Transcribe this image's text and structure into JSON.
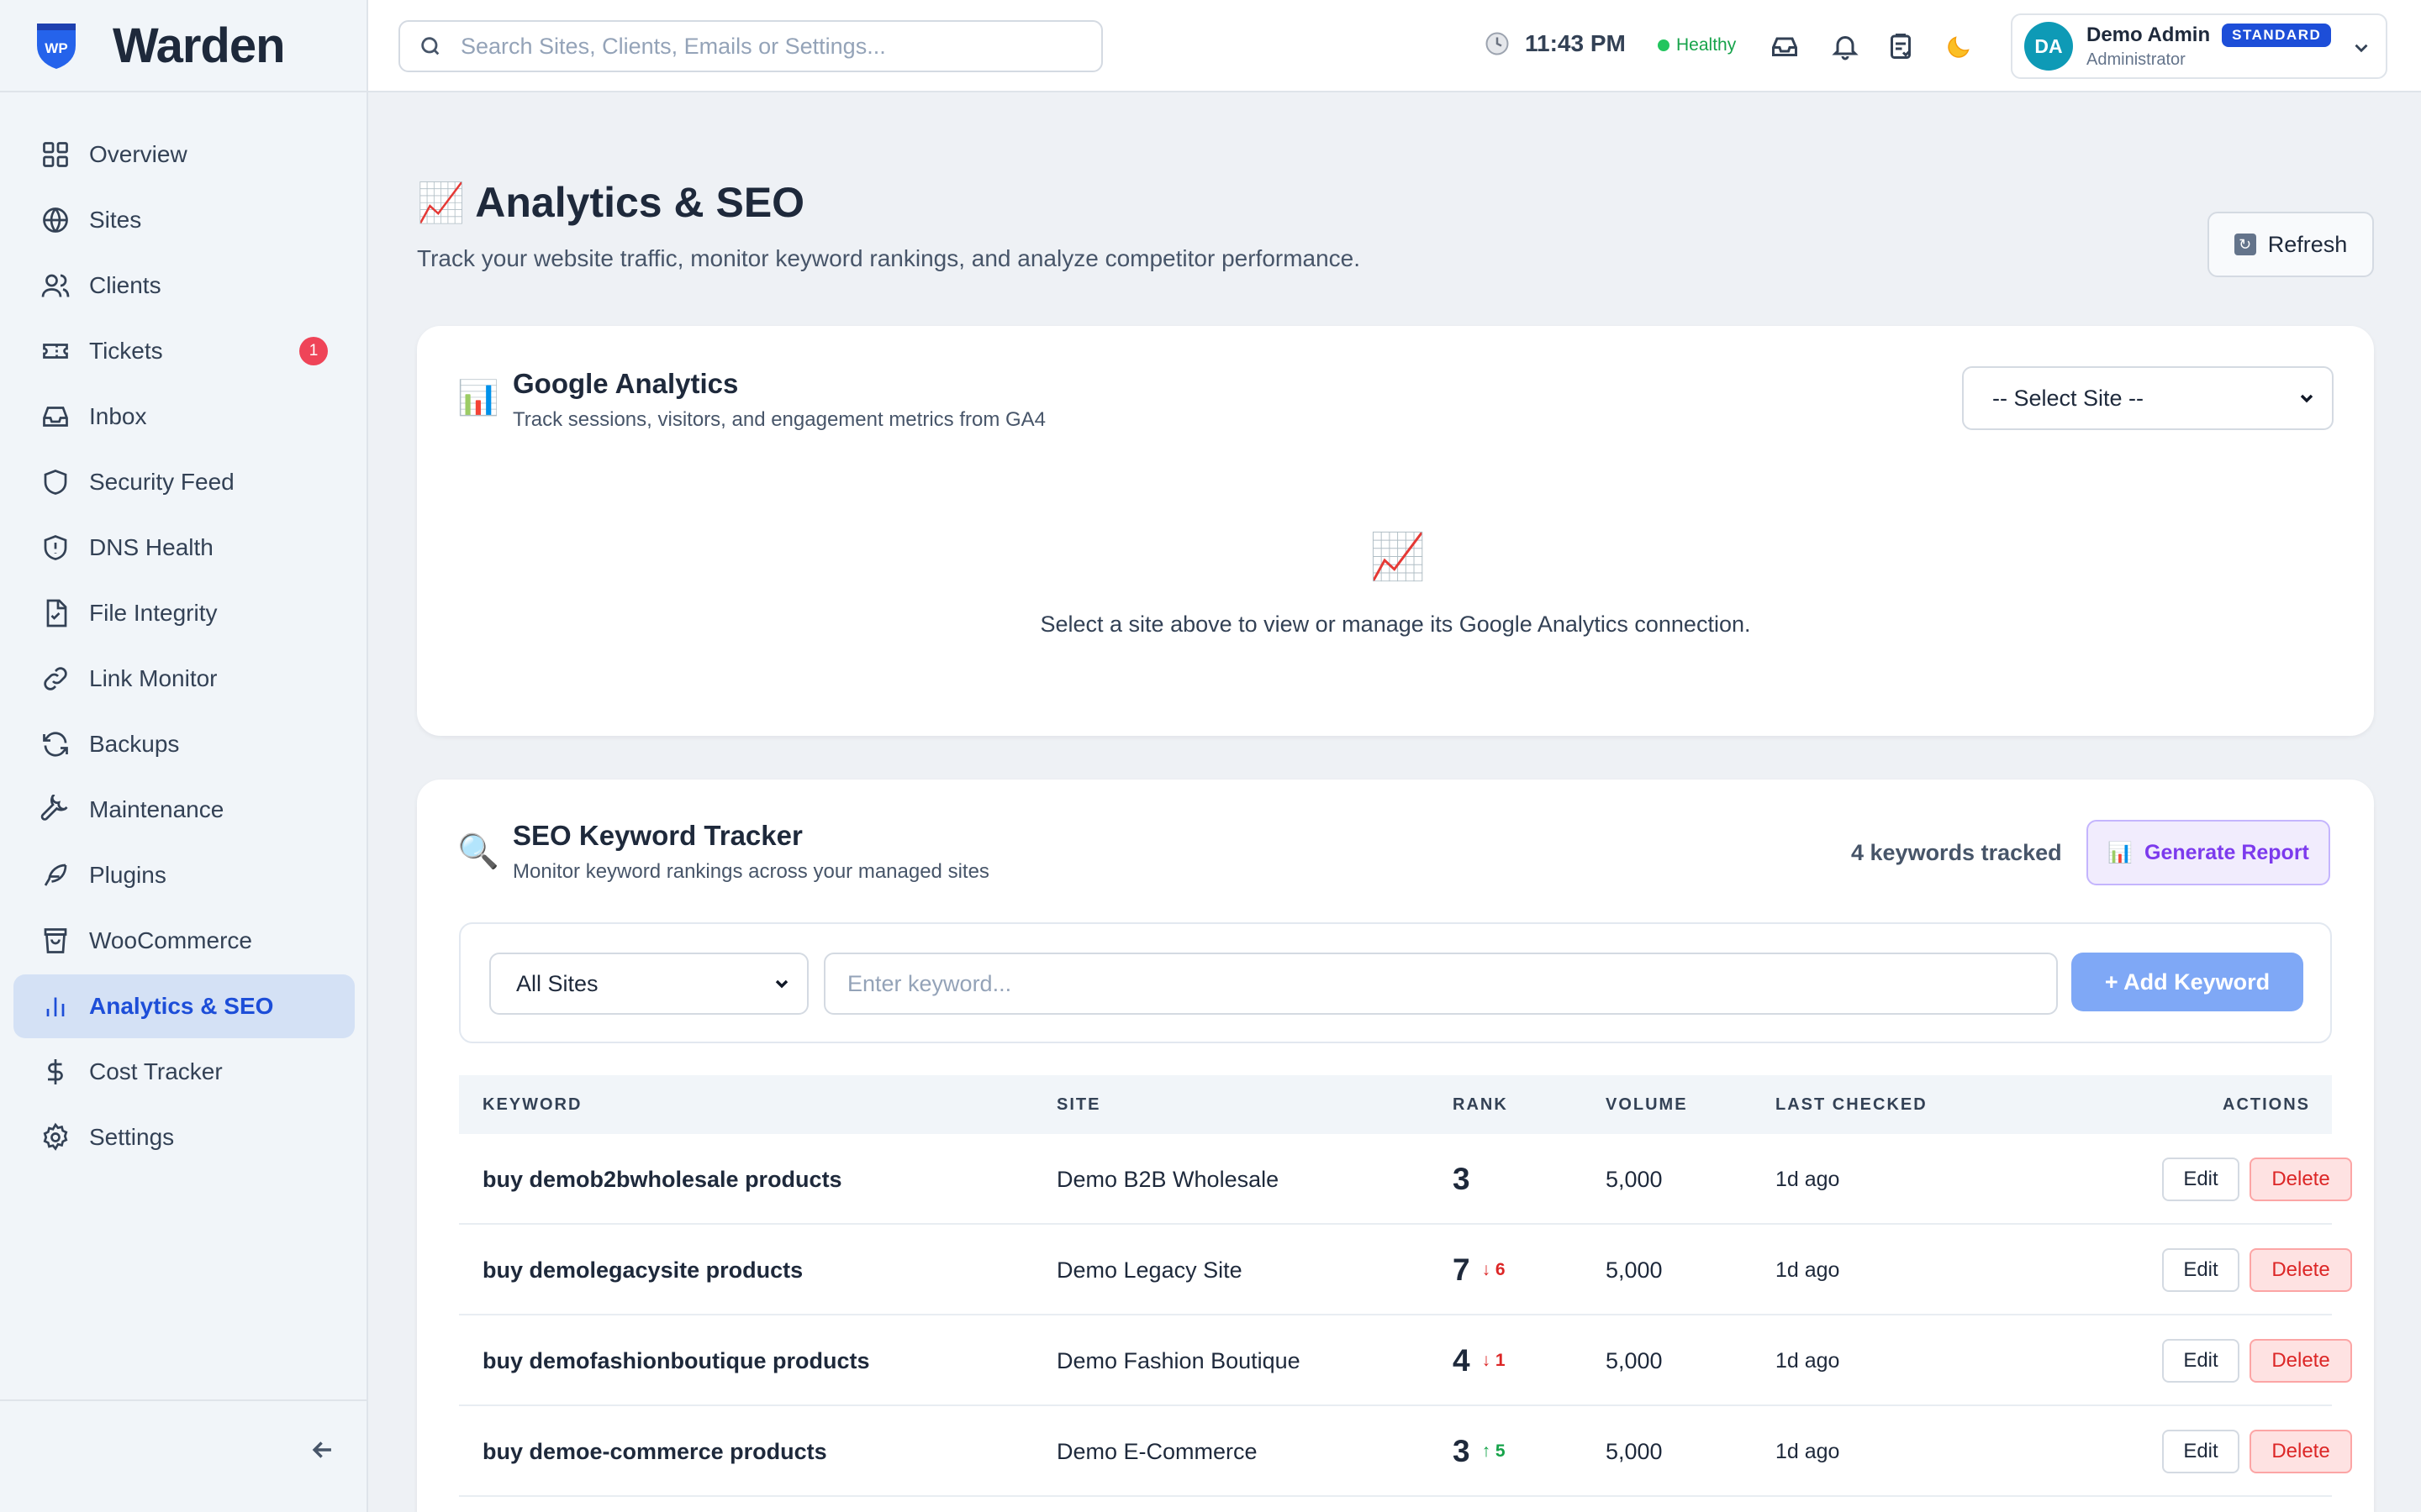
{
  "app": {
    "name": "Warden",
    "logo_badge": "WP"
  },
  "colors": {
    "accent": "#1d4ed8",
    "active_bg": "#d4e1f5",
    "danger": "#dc2626",
    "success": "#16a34a",
    "purple": "#7c3aed",
    "avatar_bg": "#0e9ab6"
  },
  "search": {
    "placeholder": "Search Sites, Clients, Emails or Settings..."
  },
  "topbar": {
    "time": "11:43 PM",
    "status": "Healthy",
    "icons": [
      "clock-icon",
      "inbox-icon",
      "bell-icon",
      "clipboard-icon",
      "moon-icon"
    ],
    "user": {
      "initials": "DA",
      "name": "Demo Admin",
      "plan": "STANDARD",
      "role": "Administrator"
    }
  },
  "sidebar": {
    "items": [
      {
        "label": "Overview",
        "icon": "grid-icon"
      },
      {
        "label": "Sites",
        "icon": "globe-icon"
      },
      {
        "label": "Clients",
        "icon": "users-icon"
      },
      {
        "label": "Tickets",
        "icon": "ticket-icon",
        "badge": "1"
      },
      {
        "label": "Inbox",
        "icon": "inbox-icon"
      },
      {
        "label": "Security Feed",
        "icon": "shield-icon"
      },
      {
        "label": "DNS Health",
        "icon": "shield-alert-icon"
      },
      {
        "label": "File Integrity",
        "icon": "file-check-icon"
      },
      {
        "label": "Link Monitor",
        "icon": "link-icon"
      },
      {
        "label": "Backups",
        "icon": "refresh-icon"
      },
      {
        "label": "Maintenance",
        "icon": "wrench-icon"
      },
      {
        "label": "Plugins",
        "icon": "feather-icon"
      },
      {
        "label": "WooCommerce",
        "icon": "shopping-bag-icon"
      },
      {
        "label": "Analytics & SEO",
        "icon": "bar-chart-icon",
        "active": true
      },
      {
        "label": "Cost Tracker",
        "icon": "dollar-icon"
      },
      {
        "label": "Settings",
        "icon": "gear-icon"
      }
    ]
  },
  "page": {
    "title_emoji": "📈",
    "title": "Analytics & SEO",
    "subtitle": "Track your website traffic, monitor keyword rankings, and analyze competitor performance.",
    "refresh_label": "Refresh"
  },
  "ga": {
    "icon": "📊",
    "title": "Google Analytics",
    "subtitle": "Track sessions, visitors, and engagement metrics from GA4",
    "select_value": "-- Select Site --",
    "empty_icon": "📈",
    "empty_text": "Select a site above to view or manage its Google Analytics connection."
  },
  "seo": {
    "icon": "🔍",
    "title": "SEO Keyword Tracker",
    "subtitle": "Monitor keyword rankings across your managed sites",
    "count_text": "4 keywords tracked",
    "report_icon": "📊",
    "report_label": "Generate Report",
    "site_filter": "All Sites",
    "keyword_placeholder": "Enter keyword...",
    "add_label": "+ Add Keyword",
    "columns": [
      "KEYWORD",
      "SITE",
      "RANK",
      "VOLUME",
      "LAST CHECKED",
      "ACTIONS"
    ],
    "rows": [
      {
        "keyword": "buy demob2bwholesale products",
        "site": "Demo B2B Wholesale",
        "rank": "3",
        "delta": "",
        "direction": "",
        "volume": "5,000",
        "checked": "1d ago"
      },
      {
        "keyword": "buy demolegacysite products",
        "site": "Demo Legacy Site",
        "rank": "7",
        "delta": "↓ 6",
        "direction": "down",
        "volume": "5,000",
        "checked": "1d ago"
      },
      {
        "keyword": "buy demofashionboutique products",
        "site": "Demo Fashion Boutique",
        "rank": "4",
        "delta": "↓ 1",
        "direction": "down",
        "volume": "5,000",
        "checked": "1d ago"
      },
      {
        "keyword": "buy demoe-commerce products",
        "site": "Demo E-Commerce",
        "rank": "3",
        "delta": "↑ 5",
        "direction": "up",
        "volume": "5,000",
        "checked": "1d ago"
      }
    ],
    "edit_label": "Edit",
    "delete_label": "Delete"
  }
}
